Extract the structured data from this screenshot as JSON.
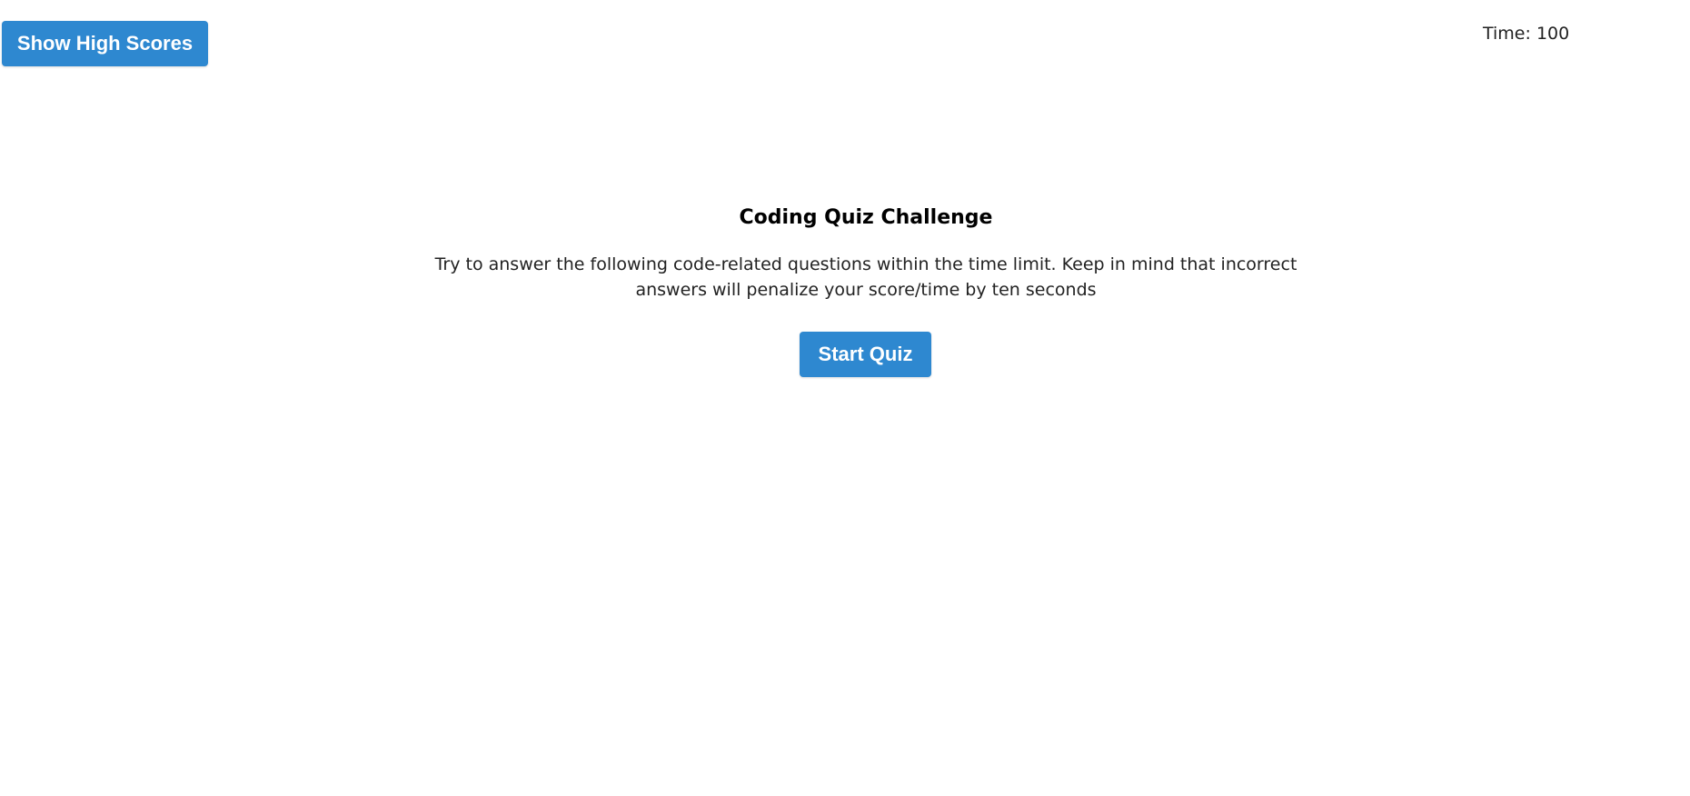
{
  "header": {
    "high_scores_button_label": "Show High Scores",
    "timer_text": "Time: 100"
  },
  "intro": {
    "title": "Coding Quiz Challenge",
    "description": "Try to answer the following code-related questions within the time limit. Keep in mind that incorrect answers will penalize your score/time by ten seconds",
    "start_button_label": "Start Quiz"
  },
  "colors": {
    "accent": "#2e88d0",
    "background": "#ffffff",
    "text": "#222222"
  }
}
